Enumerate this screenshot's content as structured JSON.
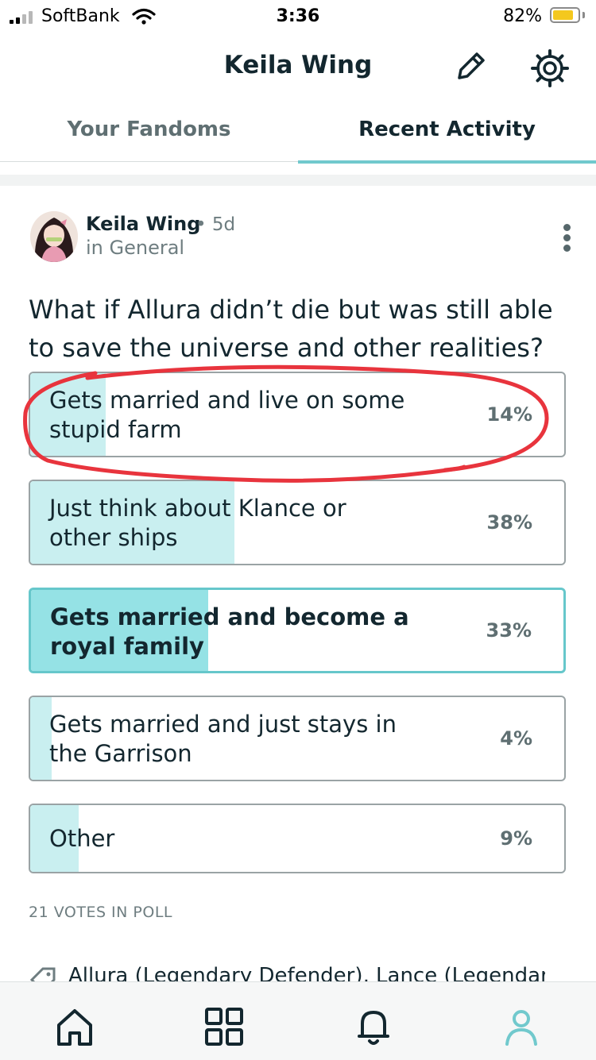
{
  "status_bar": {
    "carrier": "SoftBank",
    "time": "3:36",
    "battery": "82%",
    "battery_level": 0.82
  },
  "header": {
    "title": "Keila Wing",
    "edit_icon": "edit-pencil-icon",
    "settings_icon": "gear-icon"
  },
  "tabs": [
    {
      "label": "Your Fandoms",
      "active": false
    },
    {
      "label": "Recent Activity",
      "active": true
    }
  ],
  "post": {
    "author": "Keila Wing",
    "time_ago": "• 5d",
    "community": "in General",
    "question": "What if Allura didn’t die but was still able to save the universe and other realities?",
    "options": [
      {
        "line1": "Gets married and live on some",
        "line2": "stupid farm",
        "percent": "14%",
        "fraction": 0.14,
        "selected": false
      },
      {
        "line1": "Just think about Klance or",
        "line2": "other ships",
        "percent": "38%",
        "fraction": 0.38,
        "selected": false
      },
      {
        "line1": "Gets married and become a",
        "line2": "royal family",
        "percent": "33%",
        "fraction": 0.33,
        "selected": true
      },
      {
        "line1": "Gets married and just stays in",
        "line2": "the Garrison",
        "percent": "4%",
        "fraction": 0.04,
        "selected": false
      },
      {
        "line1": "Other",
        "line2": "",
        "percent": "9%",
        "fraction": 0.09,
        "selected": false
      }
    ],
    "votes": "21 VOTES IN POLL",
    "tags": "Allura (Legendary Defender), Lance (Legendar"
  },
  "bottom_nav": [
    {
      "icon": "home-icon"
    },
    {
      "icon": "grid-icon"
    },
    {
      "icon": "bell-icon"
    },
    {
      "icon": "profile-icon",
      "active": true
    }
  ],
  "colors": {
    "accent": "#71c9cd",
    "poll_fill": "#c9eff0",
    "poll_fill_selected": "#95e2e5",
    "annotation": "#e8343d"
  }
}
